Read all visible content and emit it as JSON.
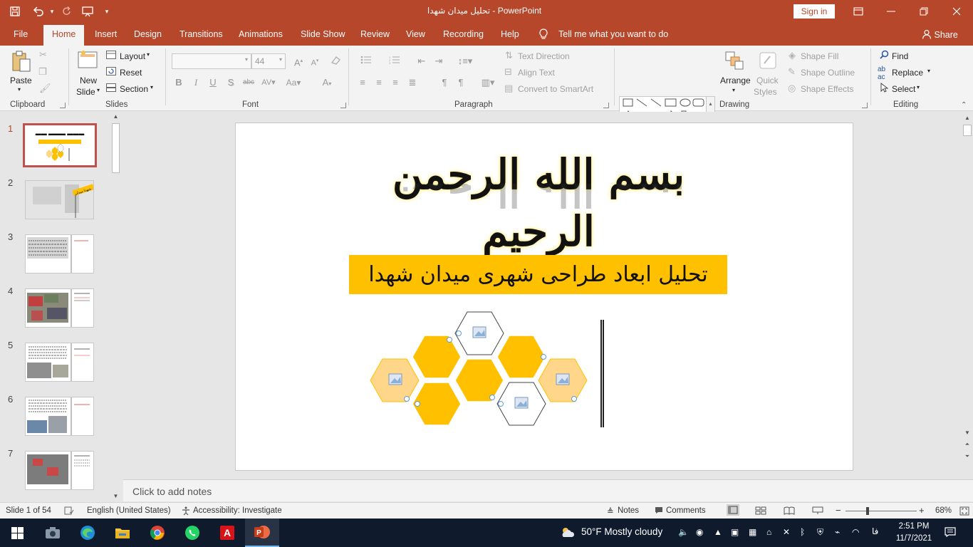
{
  "app": {
    "window_title": "تحلیل میدان شهدا - PowerPoint",
    "sign_in": "Sign in",
    "quick_access": [
      "save-icon",
      "undo-icon",
      "redo-icon",
      "present-icon"
    ]
  },
  "tabs": [
    {
      "label": "File"
    },
    {
      "label": "Home"
    },
    {
      "label": "Insert"
    },
    {
      "label": "Design"
    },
    {
      "label": "Transitions"
    },
    {
      "label": "Animations"
    },
    {
      "label": "Slide Show"
    },
    {
      "label": "Review"
    },
    {
      "label": "View"
    },
    {
      "label": "Recording"
    },
    {
      "label": "Help"
    }
  ],
  "tell_me": "Tell me what you want to do",
  "share": "Share",
  "ribbon": {
    "clipboard": {
      "label": "Clipboard",
      "paste": "Paste"
    },
    "slides": {
      "label": "Slides",
      "new_slide": "New",
      "new_slide2": "Slide",
      "layout": "Layout",
      "reset": "Reset",
      "section": "Section"
    },
    "font": {
      "label": "Font",
      "size": "44"
    },
    "paragraph": {
      "label": "Paragraph",
      "text_direction": "Text Direction",
      "align_text": "Align Text",
      "smartart": "Convert to SmartArt"
    },
    "drawing": {
      "label": "Drawing",
      "arrange": "Arrange",
      "quick_styles": "Quick",
      "quick_styles2": "Styles",
      "shape_fill": "Shape Fill",
      "shape_outline": "Shape Outline",
      "shape_effects": "Shape Effects"
    },
    "editing": {
      "label": "Editing",
      "find": "Find",
      "replace": "Replace",
      "select": "Select"
    }
  },
  "thumbnails": {
    "numbers": [
      "1",
      "2",
      "3",
      "4",
      "5",
      "6",
      "7"
    ],
    "slide2_badge": "شهدا میدان"
  },
  "slide": {
    "basmala": "بسم الله الرحمن الرحیم",
    "subtitle": "تحلیل ابعاد طراحی شهری میدان شهدا"
  },
  "notes_placeholder": "Click to add notes",
  "status": {
    "slide_of": "Slide 1 of 54",
    "language": "English (United States)",
    "accessibility": "Accessibility: Investigate",
    "notes": "Notes",
    "comments": "Comments",
    "zoom": "68%"
  },
  "taskbar": {
    "weather": "50°F  Mostly cloudy",
    "lang": "فا",
    "time": "2:51 PM",
    "date": "11/7/2021"
  },
  "colors": {
    "accent": "#b7472a",
    "honeycomb_gold": "#ffc000",
    "honeycomb_light": "#ffd68a"
  }
}
